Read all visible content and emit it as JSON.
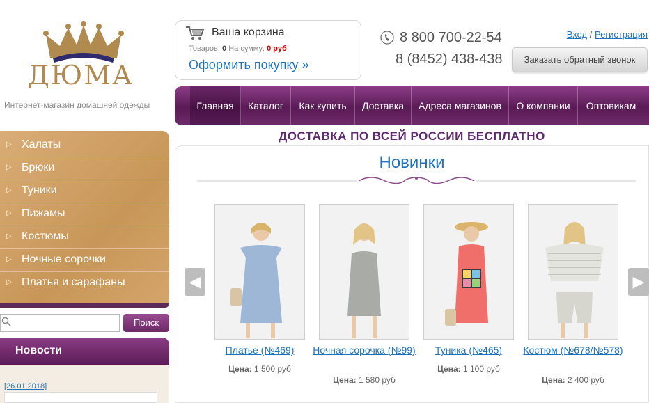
{
  "brand": {
    "logo_text": "ДЮМА",
    "tagline": "Интернет-магазин домашней одежды",
    "accent": "#6b2c68",
    "gold": "#b08a4e"
  },
  "cart": {
    "title": "Ваша корзина",
    "items_label": "Товаров:",
    "items_count": "0",
    "sum_label": "На сумму:",
    "sum_value": "0 руб",
    "checkout_link": "Оформить покупку »"
  },
  "contacts": {
    "phone1": "8 800 700-22-54",
    "phone2": "8 (8452) 438-438",
    "callback_button": "Заказать обратный звонок"
  },
  "auth": {
    "login": "Вход",
    "separator": " / ",
    "register": "Регистрация"
  },
  "nav": {
    "items": [
      "Главная",
      "Каталог",
      "Как купить",
      "Доставка",
      "Адреса магазинов",
      "О компании",
      "Оптовикам"
    ],
    "active": "Главная"
  },
  "banner": "ДОСТАВКА ПО ВСЕЙ РОССИИ БЕСПЛАТНО",
  "sidebar": {
    "menu": [
      "Халаты",
      "Брюки",
      "Туники",
      "Пижамы",
      "Костюмы",
      "Ночные сорочки",
      "Платья и сарафаны"
    ],
    "search": {
      "placeholder": "",
      "button": "Поиск"
    },
    "news": {
      "title": "Новости",
      "date": "[26.01.2018]"
    }
  },
  "section": {
    "title": "Новинки"
  },
  "products": [
    {
      "name": "Платье (№469)",
      "price_label": "Цена:",
      "price": "1 500 руб"
    },
    {
      "name": "Ночная сорочка (№99)",
      "price_label": "Цена:",
      "price": "1 580 руб"
    },
    {
      "name": "Туника (№465)",
      "price_label": "Цена:",
      "price": "1 100 руб"
    },
    {
      "name": "Костюм (№678/№578)",
      "price_label": "Цена:",
      "price": "2 400 руб"
    }
  ],
  "icons": {
    "cart": "cart-icon",
    "phone": "phone-icon",
    "search": "search-icon",
    "prev": "arrow-left-icon",
    "next": "arrow-right-icon"
  }
}
